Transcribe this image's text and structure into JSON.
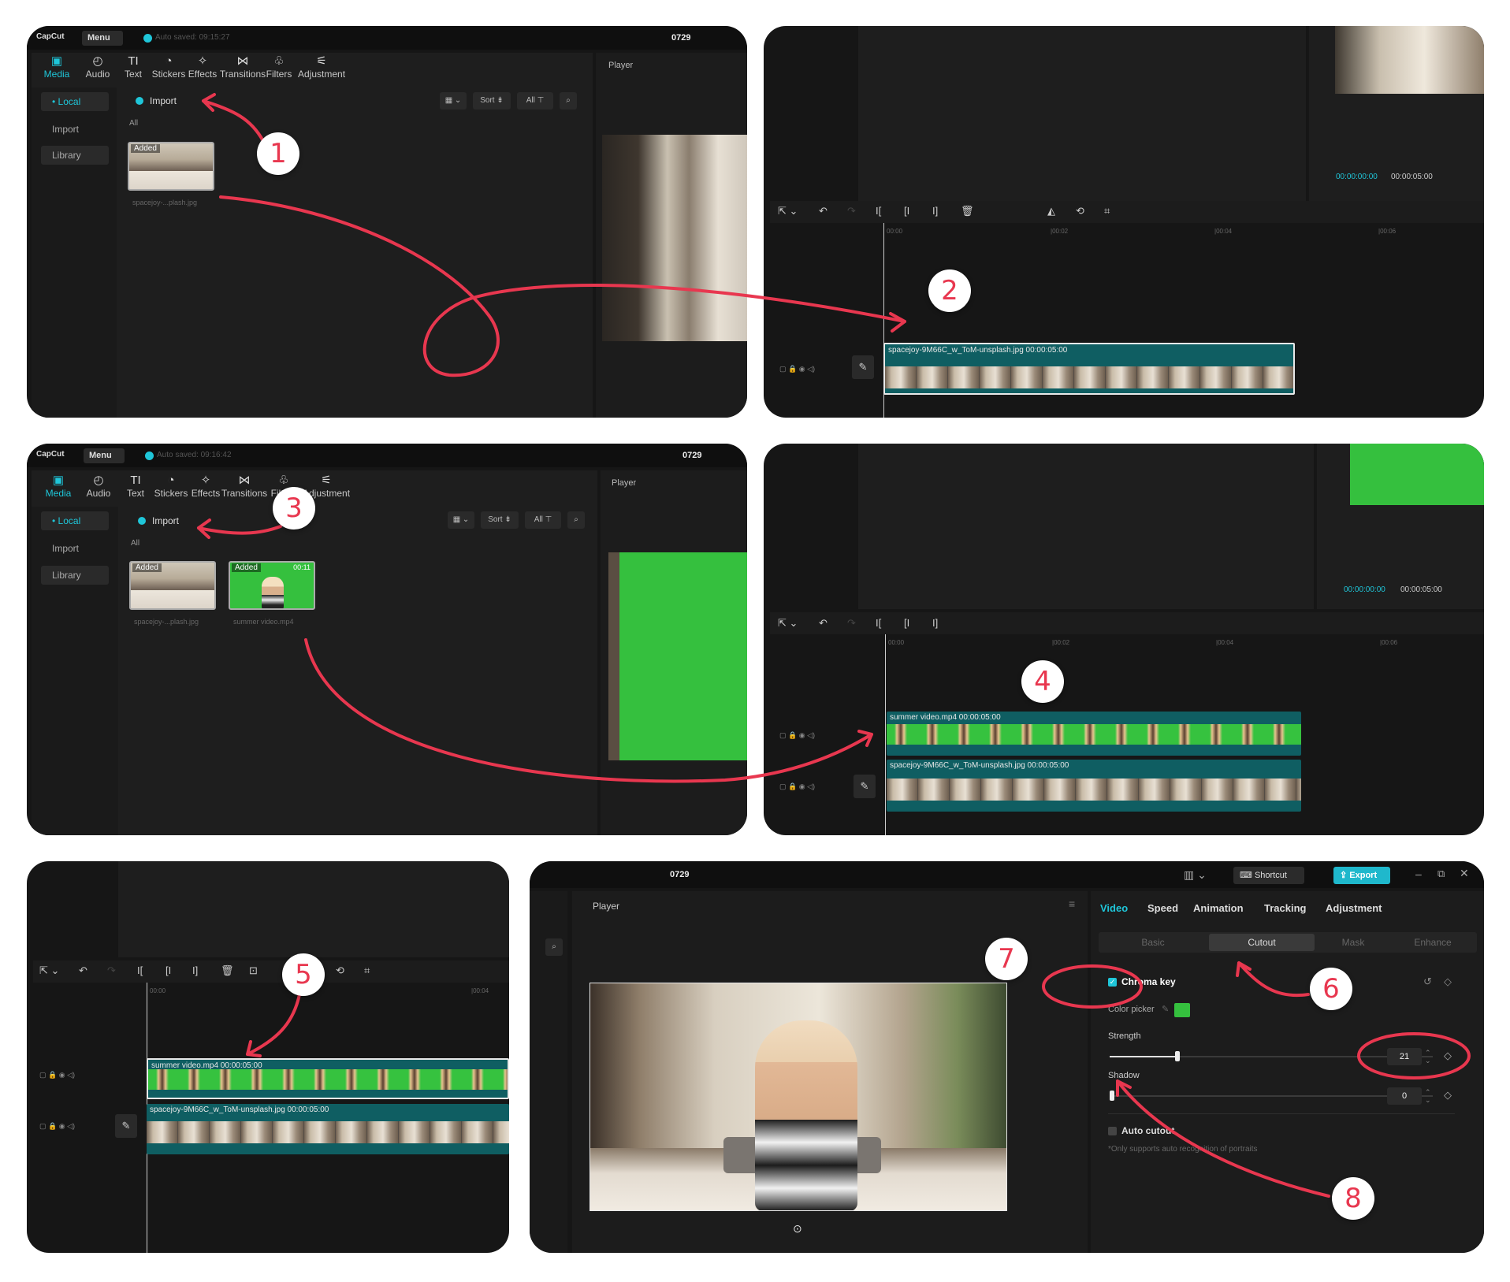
{
  "colors": {
    "accent": "#1fc6d9",
    "annotation": "#e8374f",
    "green_screen": "#35c03e",
    "panel": "#161616"
  },
  "editor": {
    "logo": "CapCut",
    "menu_label": "Menu",
    "project_name": "0729",
    "autosave_1": "Auto saved: 09:15:27",
    "autosave_2": "Auto saved: 09:16:42",
    "player_label": "Player",
    "toolbar": [
      "Media",
      "Audio",
      "Text",
      "Stickers",
      "Effects",
      "Transitions",
      "Filters",
      "Adjustment"
    ],
    "sidebar": [
      "Local",
      "Import",
      "Library"
    ],
    "import_label": "Import",
    "filter_all": "All",
    "sort_label": "Sort",
    "all_chip": "All",
    "added_badge": "Added",
    "media_image_name": "spacejoy-...plash.jpg",
    "media_video_name": "summer video.mp4",
    "media_video_duration": "00:11"
  },
  "timeline": {
    "current_time": "00:00:00:00",
    "total_time": "00:00:05:00",
    "ruler": [
      "00:00",
      "|00:02",
      "|00:04",
      "|00:06"
    ],
    "image_clip": "spacejoy-9M66C_w_ToM-unsplash.jpg  00:00:05:00",
    "video_clip": "summer video.mp4  00:00:05:00"
  },
  "properties": {
    "shortcut": "Shortcut",
    "export": "Export",
    "tabs": [
      "Video",
      "Speed",
      "Animation",
      "Tracking",
      "Adjustment"
    ],
    "subtabs": [
      "Basic",
      "Cutout",
      "Mask",
      "Enhance"
    ],
    "chroma_key": "Chroma key",
    "color_picker": "Color picker",
    "strength_label": "Strength",
    "strength_value": "21",
    "shadow_label": "Shadow",
    "shadow_value": "0",
    "auto_cutout": "Auto cutout",
    "auto_cutout_note": "*Only supports auto recognition of portraits",
    "strength_level": 0.21,
    "shadow_level": 0
  },
  "steps": [
    "1",
    "2",
    "3",
    "4",
    "5",
    "6",
    "7",
    "8"
  ]
}
